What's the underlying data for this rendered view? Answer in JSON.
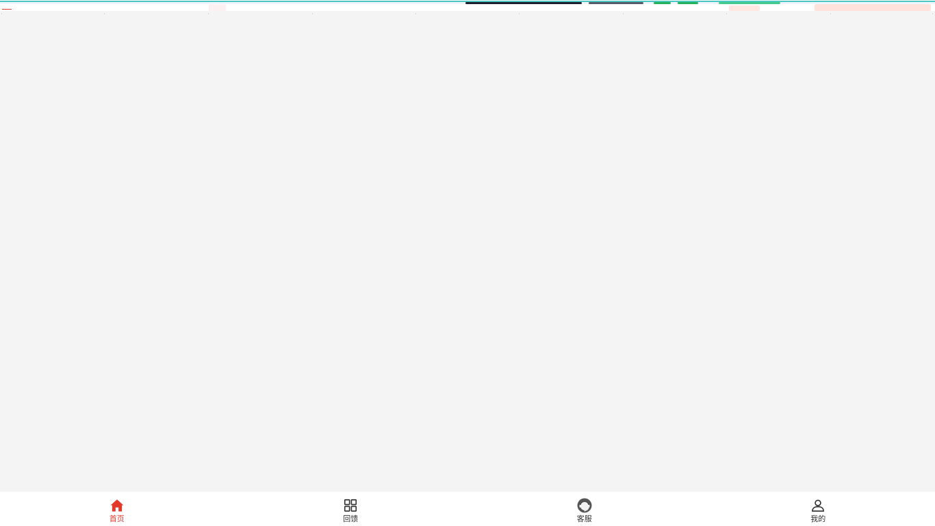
{
  "theme": {
    "accent_color": "#e3392b",
    "inactive_color": "#333333",
    "background_color": "#f4f4f4"
  },
  "tabbar": {
    "tabs": [
      {
        "label": "首页",
        "icon": "home-icon",
        "active": true
      },
      {
        "label": "回馈",
        "icon": "grid-icon",
        "active": false
      },
      {
        "label": "客服",
        "icon": "customer-service-icon",
        "active": false
      },
      {
        "label": "我的",
        "icon": "user-icon",
        "active": false
      }
    ]
  }
}
